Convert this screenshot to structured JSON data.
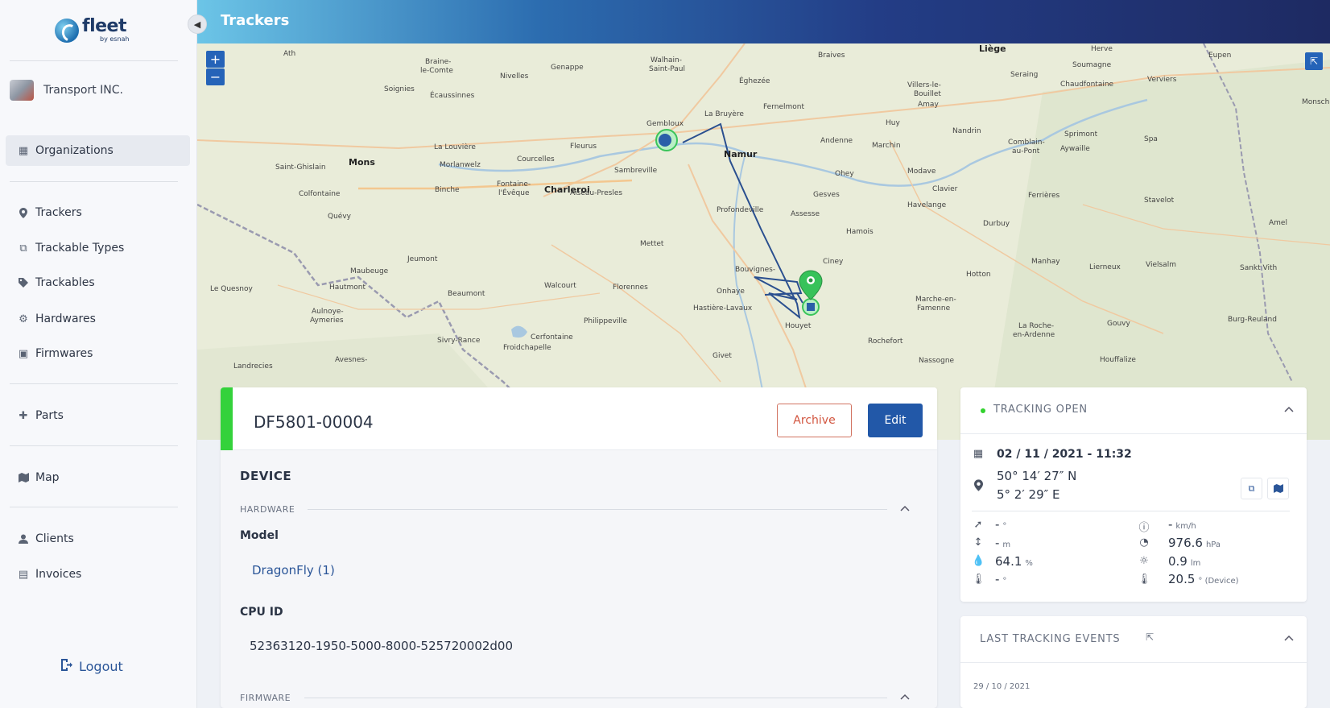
{
  "brand": {
    "name": "fleet",
    "by": "by esnah"
  },
  "org": {
    "name": "Transport INC."
  },
  "nav": {
    "organizations": "Organizations",
    "trackers": "Trackers",
    "trackable_types": "Trackable Types",
    "trackables": "Trackables",
    "hardwares": "Hardwares",
    "firmwares": "Firmwares",
    "parts": "Parts",
    "map": "Map",
    "clients": "Clients",
    "invoices": "Invoices",
    "logout": "Logout"
  },
  "header": {
    "title": "Trackers"
  },
  "map": {
    "zoom_in": "+",
    "zoom_out": "−",
    "labels": {
      "ath": "Ath",
      "braine": "Braine-",
      "lecomte": "le-Comte",
      "genappe": "Genappe",
      "walhain": "Walhain-",
      "saintpaul": "Saint-Paul",
      "braives": "Braives",
      "liege": "Liège",
      "herve": "Herve",
      "eupen": "Eupen",
      "soignies": "Soignies",
      "ecaussinnes": "Écaussinnes",
      "nivelles": "Nivelles",
      "gembloux": "Gembloux",
      "eghezee": "Éghezée",
      "villers": "Villers-le-",
      "bouillet": "Bouillet",
      "seraing": "Seraing",
      "chaudfontaine": "Chaudfontaine",
      "verviers": "Verviers",
      "labruyere": "La Bruyère",
      "fernelmont": "Fernelmont",
      "amay": "Amay",
      "huy": "Huy",
      "nandrin": "Nandrin",
      "sprimont": "Sprimont",
      "monschau": "Monschau",
      "lalouviere": "La Louvière",
      "fleurus": "Fleurus",
      "namur": "Namur",
      "andenne": "Andenne",
      "marchin": "Marchin",
      "spa": "Spa",
      "mons": "Mons",
      "saintghislain": "Saint-Ghislain",
      "morlanwelz": "Morlanwelz",
      "courcelles": "Courcelles",
      "sambreville": "Sambreville",
      "ohey": "Ohey",
      "modave": "Modave",
      "charleroi": "Charleroi",
      "binche": "Binche",
      "colfontaine": "Colfontaine",
      "fontaine": "Fontaine-",
      "leveque": "l'Évêque",
      "aiseau": "Aiseau-Presles",
      "profondeville": "Profondeville",
      "gesves": "Gesves",
      "havelange": "Havelange",
      "clavier": "Clavier",
      "ferrieres": "Ferrières",
      "stavelot": "Stavelot",
      "assesse": "Assesse",
      "hamois": "Hamois",
      "durbuy": "Durbuy",
      "amel": "Amel",
      "quevy": "Quévy",
      "mettet": "Mettet",
      "jeumont": "Jeumont",
      "maubeuge": "Maubeuge",
      "ciney": "Ciney",
      "manhay": "Manhay",
      "lierneux": "Lierneux",
      "vielsalm": "Vielsalm",
      "sanktvith": "Sankt Vith",
      "lequesnoy": "Le Quesnoy",
      "hautmont": "Hautmont",
      "beaumont": "Beaumont",
      "walcourt": "Walcourt",
      "florennes": "Florennes",
      "onhaye": "Onhaye",
      "hotton": "Hotton",
      "marche": "Marche-en-",
      "famenne": "Famenne",
      "aulnoye": "Aulnoye-",
      "aymeries": "Aymeries",
      "hastiere": "Hastière-Lavaux",
      "philippeville": "Philippeville",
      "houyet": "Houyet",
      "rochefort": "Rochefort",
      "laroche": "La Roche-",
      "ardenne": "en-Ardenne",
      "gouvy": "Gouvy",
      "burgreuland": "Burg-Reuland",
      "sivry": "Sivry-Rance",
      "froidchapelle": "Froidchapelle",
      "cerfontaine": "Cerfontaine",
      "givet": "Givet",
      "landrecies": "Landrecies",
      "avesnes": "Avesnes-",
      "nassogne": "Nassogne",
      "houffalize": "Houffalize",
      "bouvignes": "Bouvignes-",
      "soumagne": "Soumagne",
      "comblain": "Comblain-",
      "aupont": "au-Pont",
      "aywaille": "Aywaille"
    }
  },
  "device": {
    "id": "DF5801-00004",
    "archive_label": "Archive",
    "edit_label": "Edit",
    "section_title": "DEVICE",
    "hardware_title": "HARDWARE",
    "model_label": "Model",
    "model_value": "DragonFly (1)",
    "cpu_label": "CPU ID",
    "cpu_value": "52363120-1950-5000-8000-525720002d00",
    "firmware_title": "FIRMWARE"
  },
  "tracking": {
    "title": "TRACKING OPEN",
    "datetime": "02 / 11 / 2021 - 11:32",
    "lat": "50° 14′ 27″ N",
    "lon": "5° 2′ 29″ E",
    "heading": {
      "value": "-",
      "unit": "°"
    },
    "speed": {
      "value": "-",
      "unit": "km/h"
    },
    "altitude": {
      "value": "-",
      "unit": "m"
    },
    "pressure": {
      "value": "976.6",
      "unit": "hPa"
    },
    "humidity": {
      "value": "64.1",
      "unit": "%"
    },
    "light": {
      "value": "0.9",
      "unit": "lm"
    },
    "temperature": {
      "value": "-",
      "unit": "°"
    },
    "device_temperature": {
      "value": "20.5",
      "unit": "° (Device)"
    }
  },
  "events": {
    "title": "LAST TRACKING EVENTS",
    "first_date": "29 / 10 / 2021"
  },
  "colors": {
    "accent": "#2258a8",
    "status_green": "#34d23b",
    "archive_red": "#d2553f",
    "route": "#2a4f8f"
  }
}
